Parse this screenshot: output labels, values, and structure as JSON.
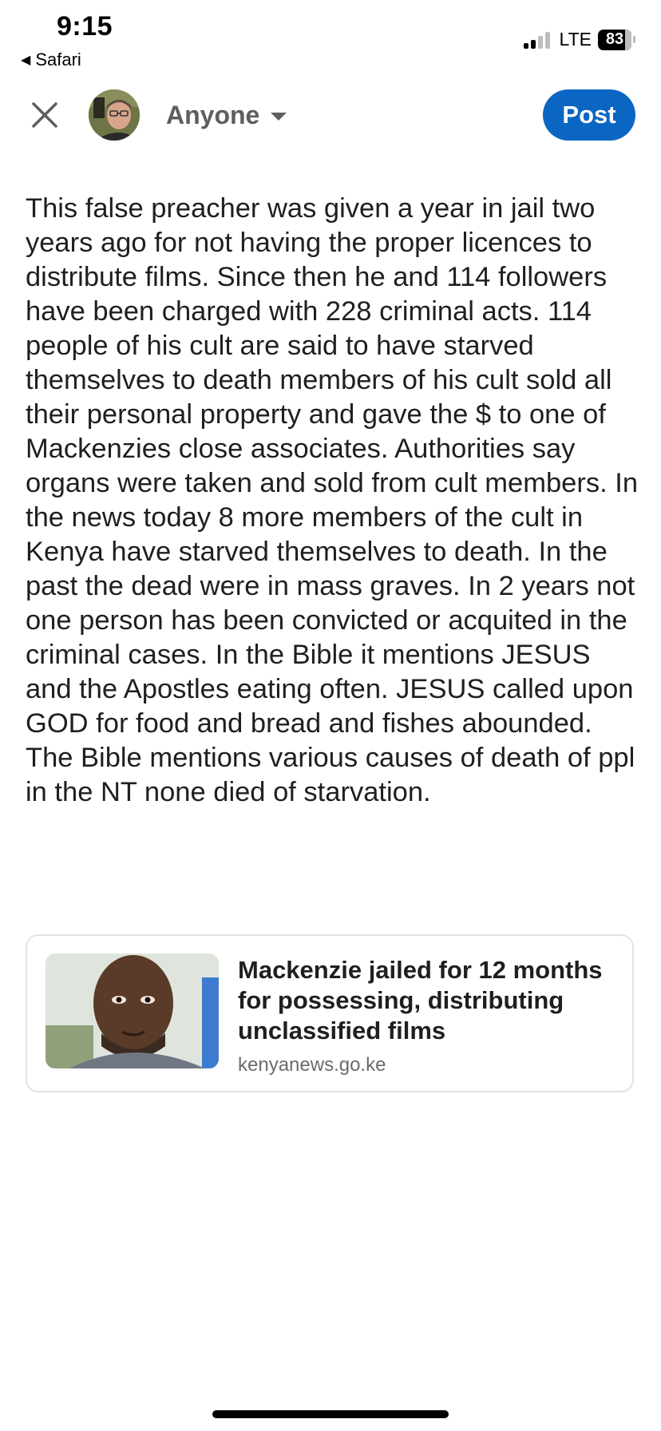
{
  "status_bar": {
    "time": "9:15",
    "back_app": "Safari",
    "network": "LTE",
    "battery": "83"
  },
  "compose": {
    "audience": "Anyone",
    "post_label": "Post",
    "text": "This false preacher was given a year in jail two years ago for not having the proper licences to distribute films. Since then he and 114 followers have been charged with 228 criminal acts. 114 people of his cult are said to have starved themselves to death members of his cult sold all their personal property and gave the $ to one of Mackenzies close associates. Authorities say organs were taken and sold from cult members. In the news today 8 more members of the cult in Kenya have starved themselves to death. In the past the dead were in mass graves. In 2 years not one person has been convicted or acquited in the criminal cases. In the Bible it mentions JESUS and the Apostles eating often. JESUS called upon GOD for food and bread and fishes abounded. The Bible mentions various causes of death of ppl in the NT none died of starvation."
  },
  "link_preview": {
    "title": "Mackenzie jailed for 12 months for possessing, distributing unclassified films",
    "domain": "kenyanews.go.ke"
  },
  "colors": {
    "accent": "#0a66c2",
    "muted_text": "#5e5e5e",
    "card_border": "#e3e3e3"
  },
  "icons": {
    "close": "close-icon",
    "back": "back-triangle-icon",
    "caret": "caret-down-icon"
  }
}
